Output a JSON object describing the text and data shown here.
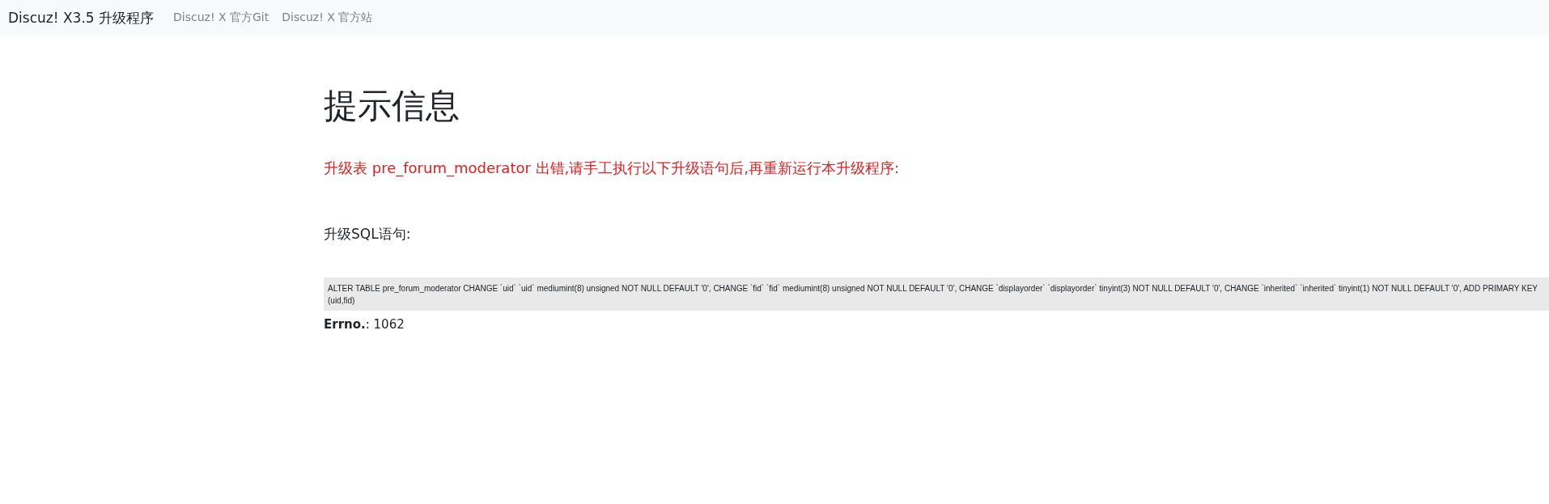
{
  "navbar": {
    "brand": "Discuz! X3.5 升级程序",
    "links": [
      "Discuz! X 官方Git",
      "Discuz! X 官方站"
    ]
  },
  "heading": "提示信息",
  "error_message": "升级表 pre_forum_moderator 出错,请手工执行以下升级语句后,再重新运行本升级程序:",
  "sql_label": "升级SQL语句:",
  "sql": "ALTER TABLE pre_forum_moderator CHANGE `uid` `uid` mediumint(8) unsigned NOT NULL DEFAULT '0', CHANGE `fid` `fid` mediumint(8) unsigned NOT NULL DEFAULT '0', CHANGE `displayorder` `displayorder` tinyint(3) NOT NULL DEFAULT '0', CHANGE `inherited` `inherited` tinyint(1) NOT NULL DEFAULT '0', ADD PRIMARY KEY (uid,fid)",
  "errno": {
    "label": "Errno.",
    "value": ": 1062"
  }
}
